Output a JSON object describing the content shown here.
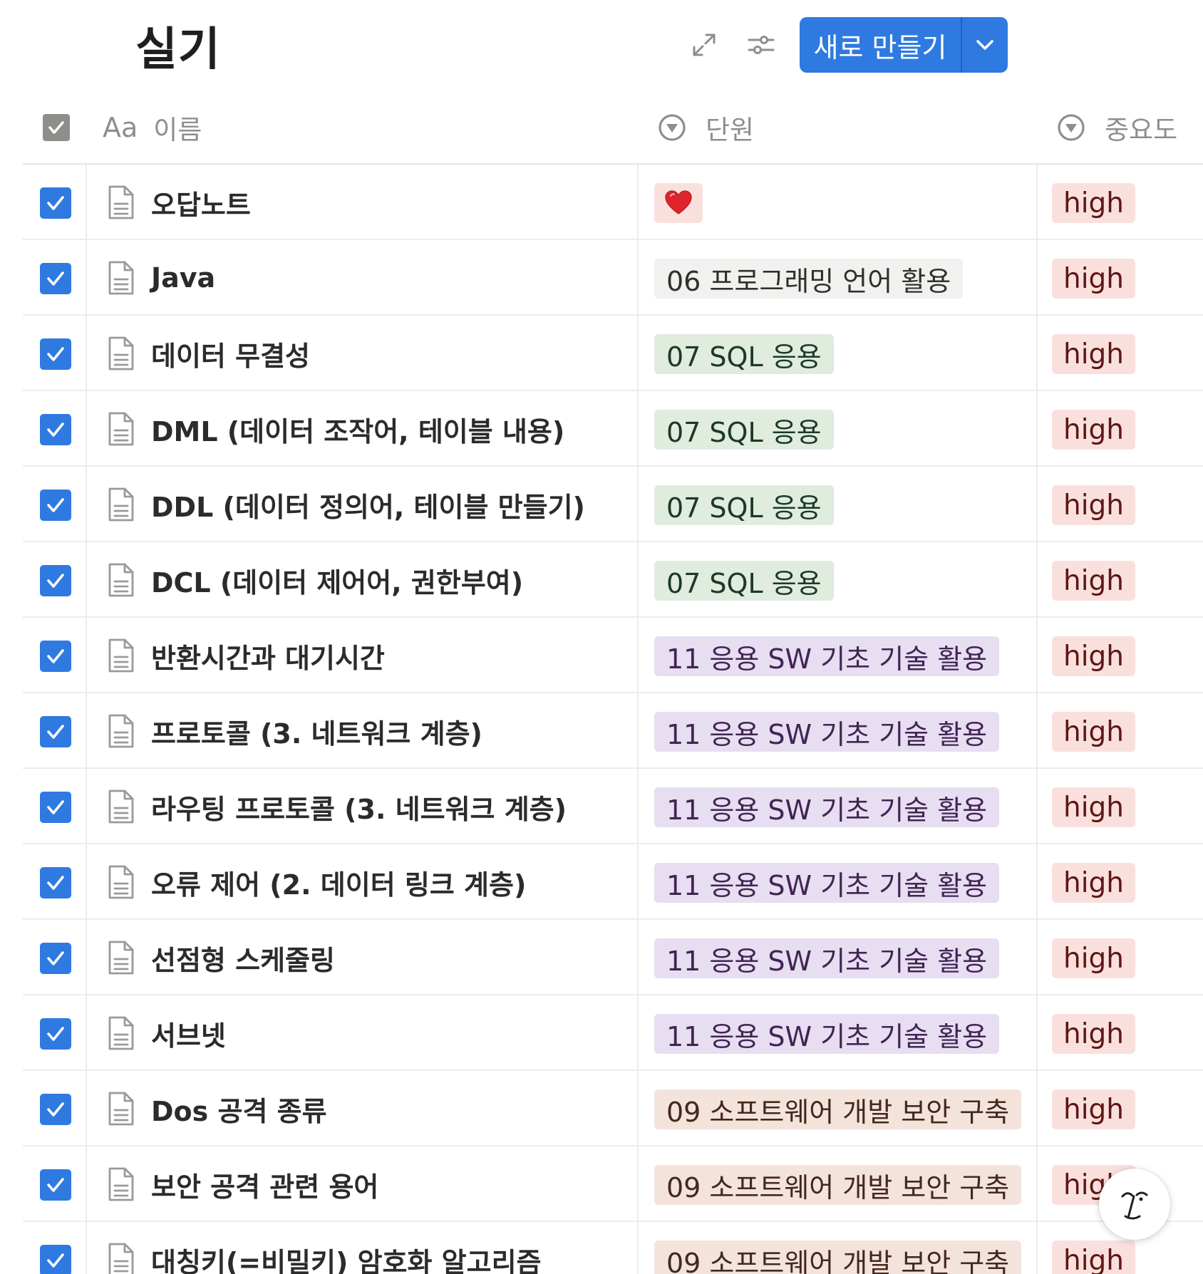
{
  "page": {
    "title": "실기"
  },
  "toolbar": {
    "expand_icon": "expand-icon",
    "filter_icon": "sliders-icon",
    "new_button_label": "새로 만들기",
    "new_button_caret_icon": "chevron-down-icon",
    "accent_color": "#2f7ae0"
  },
  "columns": {
    "name": {
      "icon": "Aa",
      "label": "이름"
    },
    "unit": {
      "icon": "select-icon",
      "label": "단원"
    },
    "importance": {
      "icon": "select-icon",
      "label": "중요도"
    }
  },
  "tag_colors": {
    "heart": {
      "bg": "#fae0dd",
      "fg": "#5d1715"
    },
    "gray": {
      "bg": "#f1f1ef",
      "fg": "#32302c"
    },
    "green": {
      "bg": "#dfecde",
      "fg": "#1c3829"
    },
    "purple": {
      "bg": "#e7def1",
      "fg": "#412454"
    },
    "brown": {
      "bg": "#f4e3da",
      "fg": "#44281d"
    },
    "high": {
      "bg": "#fae0dd",
      "fg": "#5d1715"
    }
  },
  "rows": [
    {
      "checked": true,
      "name": "오답노트",
      "unit": "",
      "unit_emoji": "heart",
      "unit_color": "heart",
      "importance": "high"
    },
    {
      "checked": true,
      "name": "Java",
      "unit": "06 프로그래밍 언어 활용",
      "unit_color": "gray",
      "importance": "high"
    },
    {
      "checked": true,
      "name": "데이터 무결성",
      "unit": "07 SQL 응용",
      "unit_color": "green",
      "importance": "high"
    },
    {
      "checked": true,
      "name": "DML (데이터 조작어, 테이블 내용)",
      "unit": "07 SQL 응용",
      "unit_color": "green",
      "importance": "high"
    },
    {
      "checked": true,
      "name": "DDL (데이터 정의어, 테이블 만들기)",
      "unit": "07 SQL 응용",
      "unit_color": "green",
      "importance": "high"
    },
    {
      "checked": true,
      "name": "DCL (데이터 제어어, 권한부여)",
      "unit": "07 SQL 응용",
      "unit_color": "green",
      "importance": "high"
    },
    {
      "checked": true,
      "name": "반환시간과 대기시간",
      "unit": "11 응용 SW 기초 기술 활용",
      "unit_color": "purple",
      "importance": "high"
    },
    {
      "checked": true,
      "name": "프로토콜 (3. 네트워크 계층)",
      "unit": "11 응용 SW 기초 기술 활용",
      "unit_color": "purple",
      "importance": "high"
    },
    {
      "checked": true,
      "name": "라우팅 프로토콜 (3. 네트워크 계층)",
      "unit": "11 응용 SW 기초 기술 활용",
      "unit_color": "purple",
      "importance": "high"
    },
    {
      "checked": true,
      "name": "오류 제어 (2. 데이터 링크 계층)",
      "unit": "11 응용 SW 기초 기술 활용",
      "unit_color": "purple",
      "importance": "high"
    },
    {
      "checked": true,
      "name": "선점형 스케줄링",
      "unit": "11 응용 SW 기초 기술 활용",
      "unit_color": "purple",
      "importance": "high"
    },
    {
      "checked": true,
      "name": "서브넷",
      "unit": "11 응용 SW 기초 기술 활용",
      "unit_color": "purple",
      "importance": "high"
    },
    {
      "checked": true,
      "name": "Dos 공격 종류",
      "unit": "09 소프트웨어 개발 보안 구축",
      "unit_color": "brown",
      "importance": "high"
    },
    {
      "checked": true,
      "name": "보안 공격 관련 용어",
      "unit": "09 소프트웨어 개발 보안 구축",
      "unit_color": "brown",
      "importance": "high"
    },
    {
      "checked": true,
      "name": "대칭키(=비밀키) 암호화 알고리즘",
      "unit": "09 소프트웨어 개발 보안 구축",
      "unit_color": "brown",
      "importance": "high"
    }
  ],
  "floating_button": {
    "icon": "notion-ai-face-icon"
  }
}
